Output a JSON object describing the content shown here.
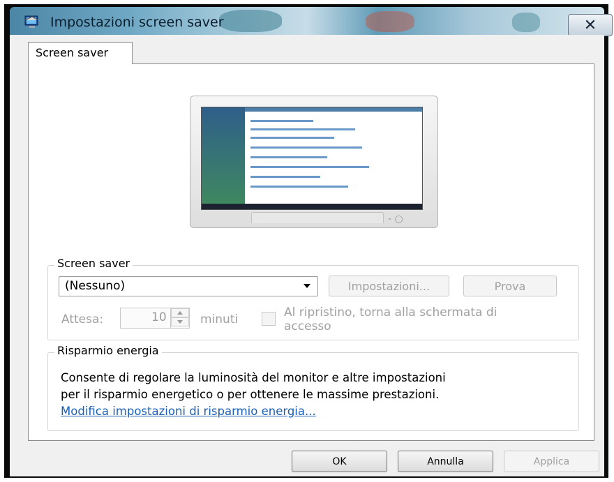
{
  "window": {
    "title": "Impostazioni screen saver",
    "close_symbol": "✕"
  },
  "tabs": [
    {
      "label": "Screen saver"
    }
  ],
  "screen_saver_group": {
    "label": "Screen saver",
    "selected": "(Nessuno)",
    "settings_button": "Impostazioni...",
    "preview_button": "Prova",
    "wait_label": "Attesa:",
    "wait_value": "10",
    "minutes_label": "minuti",
    "resume_line1": "Al ripristino, torna alla schermata di",
    "resume_line2": "accesso"
  },
  "power_group": {
    "label": "Risparmio energia",
    "description_line1": "Consente di regolare la luminosità del monitor e altre impostazioni",
    "description_line2": "per il risparmio energetico o per ottenere le massime prestazioni.",
    "link": "Modifica impostazioni di risparmio energia..."
  },
  "footer": {
    "ok": "OK",
    "cancel": "Annulla",
    "apply": "Applica"
  },
  "icons": {
    "app": "screen-saver-app-icon",
    "close": "close-icon",
    "dropdown": "chevron-down-icon"
  }
}
